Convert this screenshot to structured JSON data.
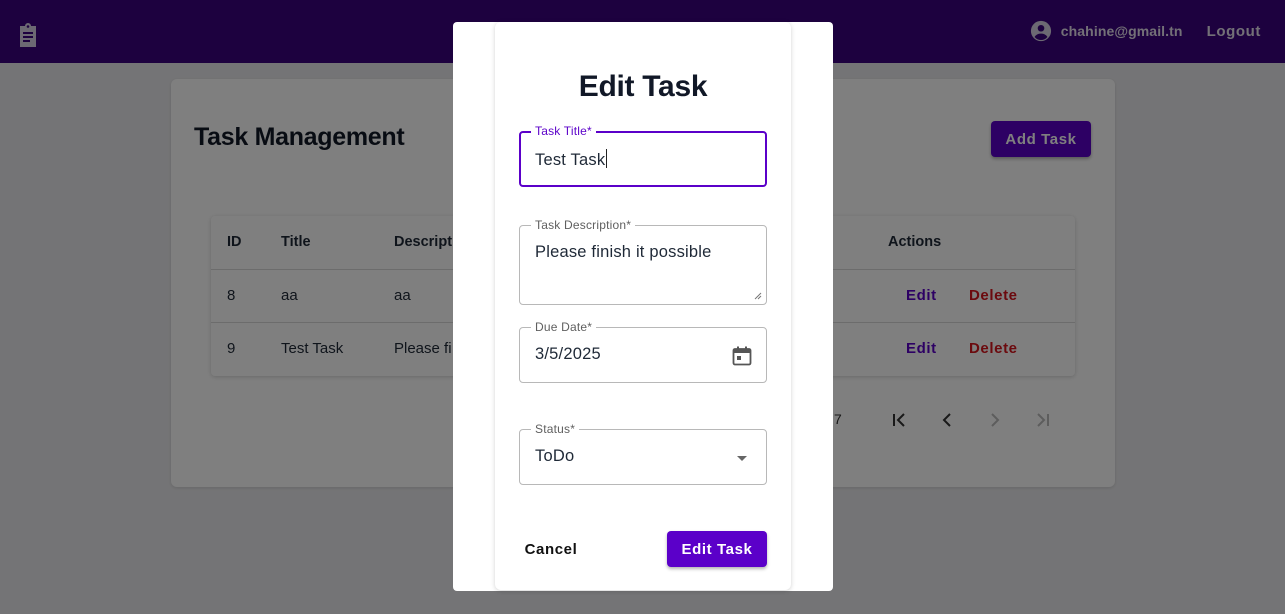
{
  "appbar": {
    "app_icon": "clipboard-icon",
    "user_icon": "account-circle-icon",
    "user_email": "chahine@gmail.tn",
    "logout_label": "Logout"
  },
  "main": {
    "title": "Task Management",
    "add_task_label": "Add Task",
    "table": {
      "columns": [
        "ID",
        "Title",
        "Descriptio",
        "Actions"
      ],
      "rows": [
        {
          "id": "8",
          "title": "aa",
          "description": "aa",
          "edit": "Edit",
          "delete": "Delete"
        },
        {
          "id": "9",
          "title": "Test Task",
          "description": "Please fi",
          "edit": "Edit",
          "delete": "Delete"
        }
      ]
    },
    "pagination": {
      "range_text": "7",
      "icons": [
        "first-page-icon",
        "prev-page-icon",
        "next-page-icon",
        "last-page-icon"
      ]
    }
  },
  "dialog": {
    "title": "Edit Task",
    "fields": {
      "title": {
        "label": "Task Title*",
        "value": "Test Task"
      },
      "description": {
        "label": "Task Description*",
        "value": "Please finish it possible"
      },
      "due_date": {
        "label": "Due Date*",
        "value": "3/5/2025",
        "icon": "calendar-icon"
      },
      "status": {
        "label": "Status*",
        "value": "ToDo",
        "icon": "arrow-drop-down-icon"
      }
    },
    "cancel_label": "Cancel",
    "submit_label": "Edit Task"
  },
  "colors": {
    "appbar": "#3a027e",
    "primary": "#5b00c9",
    "danger": "#d7141d",
    "backdrop": "rgba(0,0,0,0.5)"
  }
}
